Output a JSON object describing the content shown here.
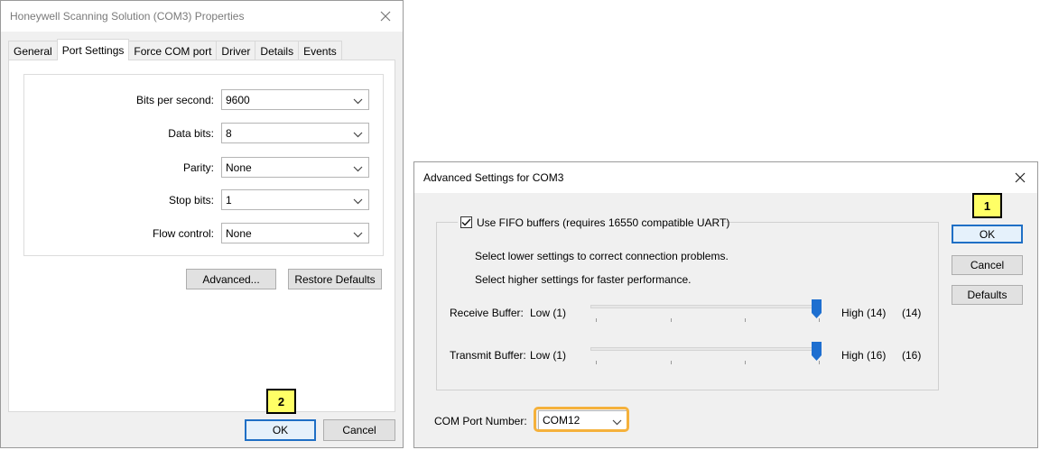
{
  "properties": {
    "title": "Honeywell Scanning Solution (COM3) Properties",
    "tabs": [
      "General",
      "Port Settings",
      "Force COM port",
      "Driver",
      "Details",
      "Events"
    ],
    "active_tab": "Port Settings",
    "fields": {
      "bits_label": "Bits per second:",
      "bits_value": "9600",
      "data_label": "Data bits:",
      "data_value": "8",
      "parity_label": "Parity:",
      "parity_value": "None",
      "stop_label": "Stop bits:",
      "stop_value": "1",
      "flow_label": "Flow control:",
      "flow_value": "None"
    },
    "advanced_label": "Advanced...",
    "restore_label": "Restore Defaults",
    "ok_label": "OK",
    "cancel_label": "Cancel"
  },
  "advanced": {
    "title": "Advanced Settings for COM3",
    "fifo_label": "Use FIFO buffers (requires 16550 compatible UART)",
    "fifo_checked": true,
    "hint1": "Select lower settings to correct connection problems.",
    "hint2": "Select higher settings for faster performance.",
    "receive": {
      "label": "Receive Buffer:",
      "low": "Low (1)",
      "high": "High (14)",
      "value": "(14)",
      "level": 14,
      "max": 14
    },
    "transmit": {
      "label": "Transmit Buffer:",
      "low": "Low (1)",
      "high": "High (16)",
      "value": "(16)",
      "level": 16,
      "max": 16
    },
    "com_port_label": "COM Port Number:",
    "com_port_value": "COM12",
    "ok_label": "OK",
    "cancel_label": "Cancel",
    "defaults_label": "Defaults"
  },
  "callouts": {
    "one": "1",
    "two": "2"
  },
  "colors": {
    "accent_focus": "#1f6fc5",
    "callout_fill": "#ffff66",
    "highlight_orange": "#f5b13b",
    "highlight_blue": "#3b74b9",
    "slider_thumb": "#1e6fd0"
  }
}
